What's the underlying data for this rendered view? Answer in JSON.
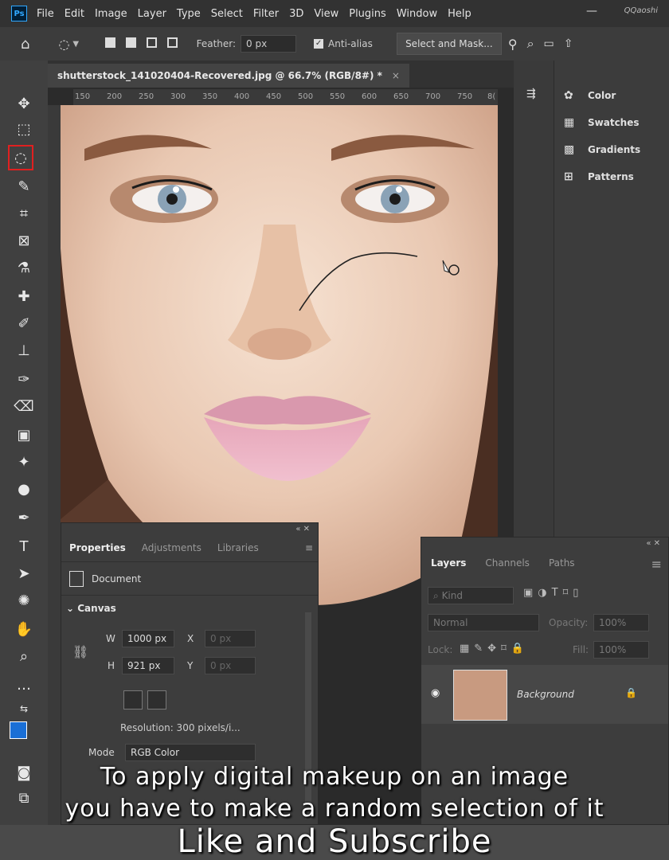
{
  "menubar": {
    "logo": "Ps",
    "items": [
      "File",
      "Edit",
      "Image",
      "Layer",
      "Type",
      "Select",
      "Filter",
      "3D",
      "View",
      "Plugins",
      "Window",
      "Help"
    ],
    "watermark": "QQaoshi"
  },
  "options_bar": {
    "feather_label": "Feather:",
    "feather_value": "0 px",
    "antialias_label": "Anti-alias",
    "select_mask_label": "Select and Mask..."
  },
  "document": {
    "tab_title": "shutterstock_141020404-Recovered.jpg @ 66.7% (RGB/8#) *",
    "ruler_ticks": [
      "150",
      "200",
      "250",
      "300",
      "350",
      "400",
      "450",
      "500",
      "550",
      "600",
      "650",
      "700",
      "750",
      "8("
    ]
  },
  "right_panel": {
    "items": [
      {
        "label": "Color",
        "icon": "palette-icon"
      },
      {
        "label": "Swatches",
        "icon": "grid-icon"
      },
      {
        "label": "Gradients",
        "icon": "gradient-icon"
      },
      {
        "label": "Patterns",
        "icon": "pattern-icon"
      }
    ]
  },
  "properties": {
    "tabs": [
      "Properties",
      "Adjustments",
      "Libraries"
    ],
    "doc_label": "Document",
    "section": "Canvas",
    "w_label": "W",
    "w_value": "1000 px",
    "h_label": "H",
    "h_value": "921 px",
    "x_label": "X",
    "x_value": "0 px",
    "y_label": "Y",
    "y_value": "0 px",
    "resolution": "Resolution: 300 pixels/i...",
    "mode_label": "Mode",
    "mode_value": "RGB Color"
  },
  "layers": {
    "tabs": [
      "Layers",
      "Channels",
      "Paths"
    ],
    "kind_placeholder": "Kind",
    "blend_mode": "Normal",
    "opacity_label": "Opacity:",
    "opacity_value": "100%",
    "lock_label": "Lock:",
    "fill_label": "Fill:",
    "fill_value": "100%",
    "layer_name": "Background"
  },
  "captions": {
    "line1": "To apply digital makeup on an image",
    "line2": "you have to make a random selection of it",
    "line3": "Like and Subscribe"
  },
  "colors": {
    "foreground": "#1a6fd6",
    "background": "#ffffff",
    "active_tool_outline": "#e02020"
  }
}
